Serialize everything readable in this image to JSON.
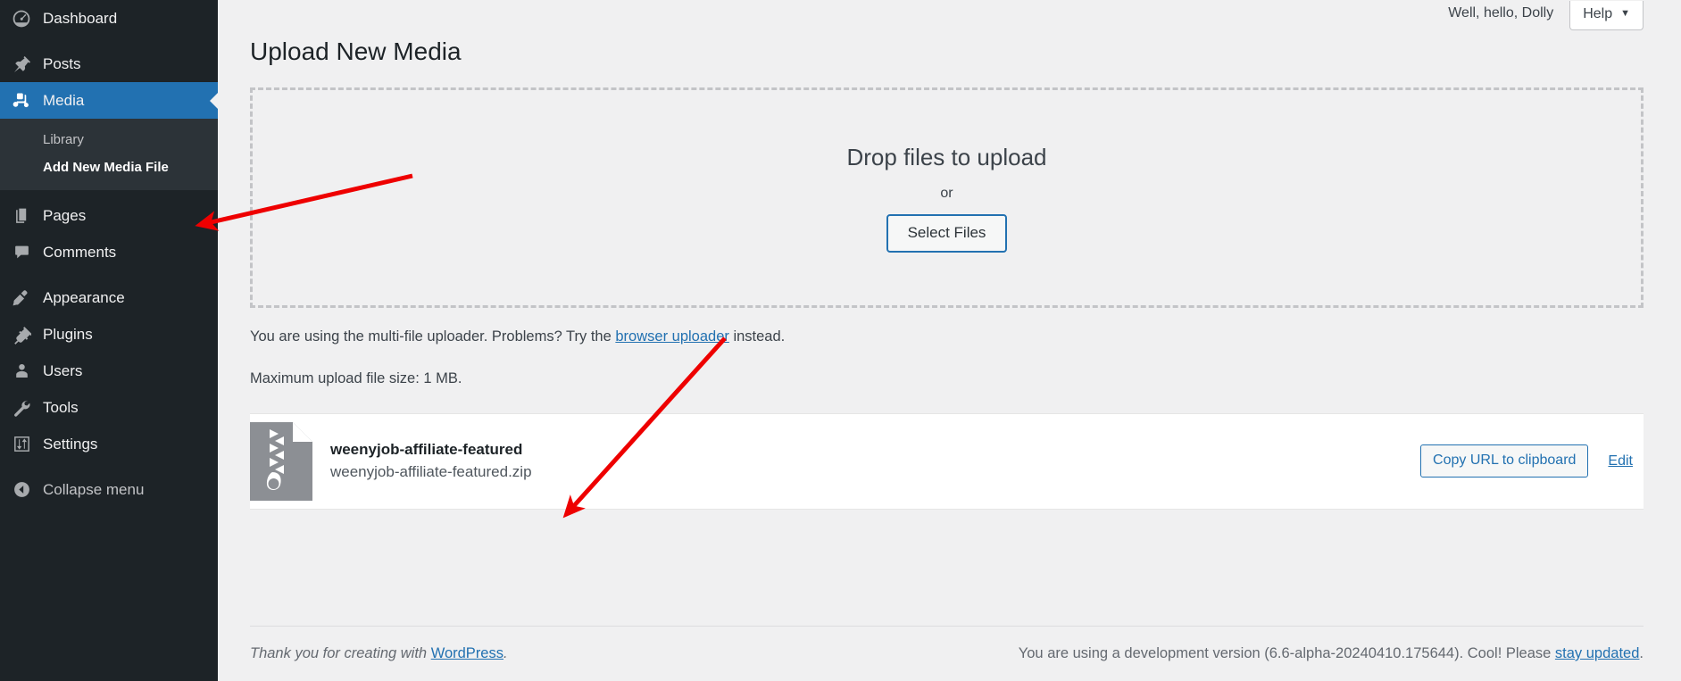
{
  "sidebar": {
    "items": [
      {
        "label": "Dashboard",
        "icon": "dashboard-icon",
        "current": false
      },
      {
        "label": "Posts",
        "icon": "pin-icon",
        "current": false
      },
      {
        "label": "Media",
        "icon": "media-icon",
        "current": true
      },
      {
        "label": "Pages",
        "icon": "pages-icon",
        "current": false
      },
      {
        "label": "Comments",
        "icon": "comments-icon",
        "current": false
      },
      {
        "label": "Appearance",
        "icon": "paintbrush-icon",
        "current": false
      },
      {
        "label": "Plugins",
        "icon": "plugin-icon",
        "current": false
      },
      {
        "label": "Users",
        "icon": "user-icon",
        "current": false
      },
      {
        "label": "Tools",
        "icon": "wrench-icon",
        "current": false
      },
      {
        "label": "Settings",
        "icon": "settings-sliders-icon",
        "current": false
      },
      {
        "label": "Collapse menu",
        "icon": "collapse-arrow-icon",
        "current": false
      }
    ],
    "submenu": [
      {
        "label": "Library",
        "active": false
      },
      {
        "label": "Add New Media File",
        "active": true
      }
    ]
  },
  "topbar": {
    "greeting": "Well, hello, Dolly",
    "help_label": "Help",
    "help_caret": "▼"
  },
  "page": {
    "title": "Upload New Media"
  },
  "dropzone": {
    "title": "Drop files to upload",
    "or": "or",
    "select_files_label": "Select Files"
  },
  "notices": {
    "uploader_prefix": "You are using the multi-file uploader. Problems? Try the ",
    "uploader_link": "browser uploader",
    "uploader_suffix": " instead.",
    "max_size": "Maximum upload file size: 1 MB."
  },
  "file": {
    "title": "weenyjob-affiliate-featured",
    "filename": "weenyjob-affiliate-featured.zip",
    "icon": "zip-file-icon",
    "copy_url_label": "Copy URL to clipboard",
    "edit_label": "Edit"
  },
  "footer": {
    "left_prefix": "Thank you for creating with ",
    "left_link": "WordPress",
    "left_suffix": ".",
    "right_prefix": "You are using a development version (6.6-alpha-20240410.175644). Cool! Please ",
    "right_link": "stay updated",
    "right_suffix": "."
  },
  "colors": {
    "sidebar_bg": "#1d2327",
    "submenu_bg": "#2c3338",
    "accent_blue": "#2271b1",
    "page_bg": "#f0f0f1",
    "annotation_red": "#ee0000",
    "zip_icon_gray": "#8c8f94"
  },
  "annotations": [
    {
      "name": "arrow-to-add-new-media-file"
    },
    {
      "name": "arrow-to-uploaded-file"
    }
  ]
}
